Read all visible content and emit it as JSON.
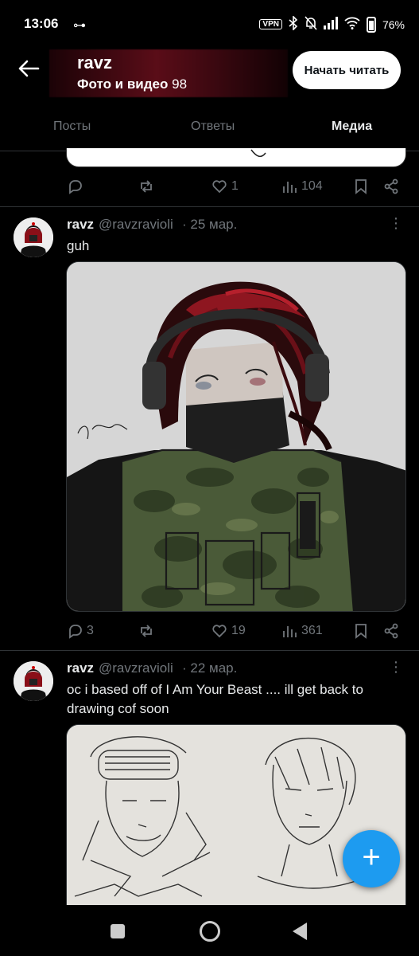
{
  "status_bar": {
    "time": "13:06",
    "key_glyph": "⊶",
    "vpn": "VPN",
    "battery": "76%"
  },
  "header": {
    "name": "ravz",
    "subtitle_label": "Фото и видео",
    "subtitle_count": "98",
    "follow_button": "Начать читать"
  },
  "tabs": [
    {
      "label": "Посты",
      "active": false
    },
    {
      "label": "Ответы",
      "active": false
    },
    {
      "label": "Медиа",
      "active": true
    }
  ],
  "prev_post": {
    "likes": "1",
    "views": "104"
  },
  "posts": [
    {
      "name": "ravz",
      "handle": "@ravzravioli",
      "date": "· 25 мар.",
      "text": "guh",
      "replies": "3",
      "likes": "19",
      "views": "361"
    },
    {
      "name": "ravz",
      "handle": "@ravzravioli",
      "date": "· 22 мар.",
      "text": "oc i based off of I Am Your Beast .... ill get back to drawing cof soon"
    }
  ],
  "fab": {
    "glyph": "+"
  },
  "colors": {
    "accent": "#1d9bf0",
    "muted": "#71767b",
    "background": "#000000"
  }
}
